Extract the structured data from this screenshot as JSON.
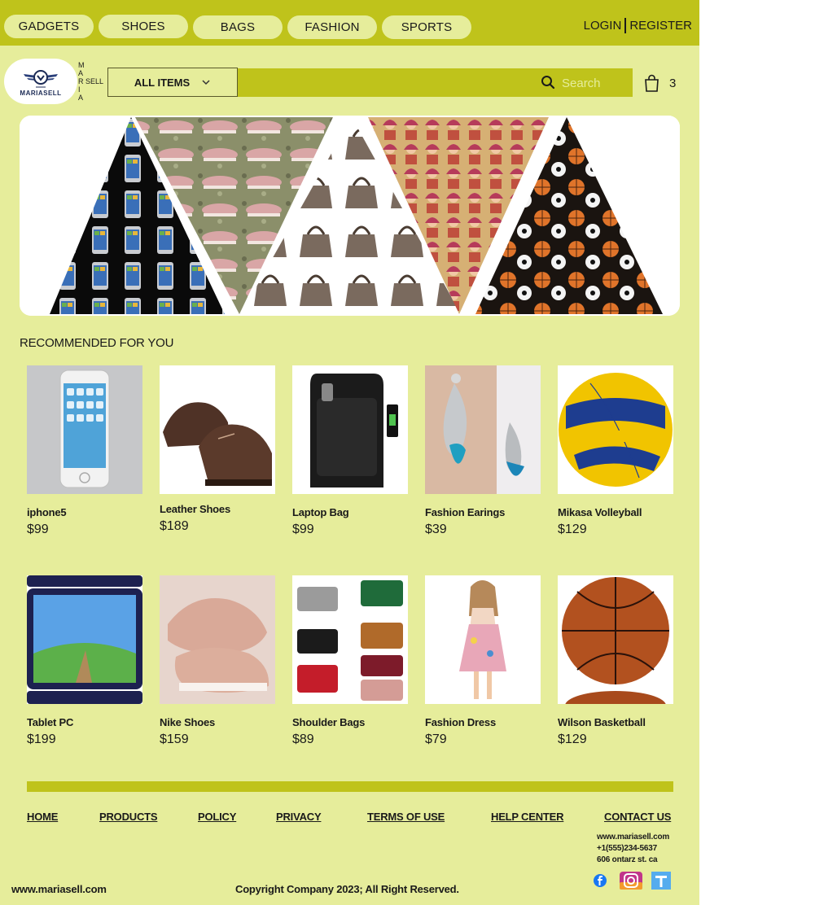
{
  "categories": [
    "GADGETS",
    "SHOES",
    "BAGS",
    "FASHION",
    "SPORTS"
  ],
  "auth": {
    "login": "LOGIN",
    "register": "REGISTER"
  },
  "logo": {
    "text": "MARIASELL",
    "vertical": [
      "M",
      "A",
      "R",
      "I",
      "A"
    ],
    "sell": "SELL"
  },
  "filter": {
    "label": "ALL ITEMS"
  },
  "search": {
    "placeholder": "Search"
  },
  "cart": {
    "count": "3"
  },
  "hero": {
    "panels": [
      "gadgets",
      "shoes",
      "bags",
      "fashion",
      "sports"
    ]
  },
  "recommended": {
    "title": "RECOMMENDED FOR YOU",
    "products": [
      {
        "name": "iphone5",
        "price": "$99",
        "image": "iphone-image"
      },
      {
        "name": "Leather Shoes",
        "price": "$189",
        "image": "leather-shoes-image"
      },
      {
        "name": "Laptop Bag",
        "price": "$99",
        "image": "laptop-bag-image"
      },
      {
        "name": "Fashion Earings",
        "price": "$39",
        "image": "earrings-image"
      },
      {
        "name": "Mikasa Volleyball",
        "price": "$129",
        "image": "volleyball-image"
      },
      {
        "name": "Tablet PC",
        "price": "$199",
        "image": "tablet-image"
      },
      {
        "name": "Nike Shoes",
        "price": "$159",
        "image": "nike-shoes-image"
      },
      {
        "name": "Shoulder Bags",
        "price": "$89",
        "image": "shoulder-bags-image"
      },
      {
        "name": "Fashion Dress",
        "price": "$79",
        "image": "dress-image"
      },
      {
        "name": "Wilson Basketball",
        "price": "$129",
        "image": "basketball-image"
      }
    ]
  },
  "footer": {
    "links": [
      "HOME",
      "PRODUCTS",
      "POLICY",
      "PRIVACY",
      "TERMS OF USE",
      "HELP CENTER",
      "CONTACT US"
    ],
    "contact": {
      "website": "www.mariasell.com",
      "phone": "+1(555)234-5637",
      "address": "606 ontarz st. ca"
    },
    "social": [
      "facebook-icon",
      "instagram-icon",
      "twitter-icon"
    ],
    "url": "www.mariasell.com",
    "copyright": "Copyright Company 2023; All Right Reserved."
  },
  "colors": {
    "background": "#e6ed9b",
    "accent": "#bfc31b",
    "text": "#1a1a1a"
  }
}
